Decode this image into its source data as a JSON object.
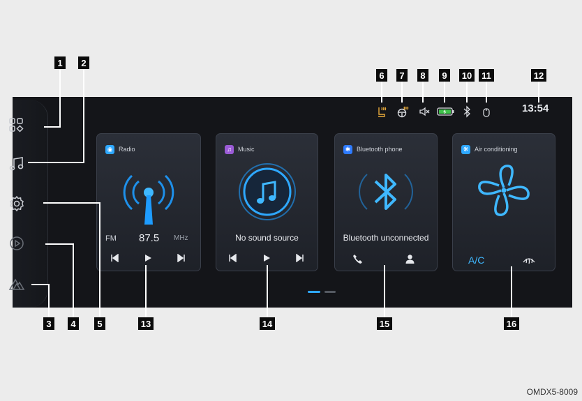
{
  "status": {
    "time": "13:54"
  },
  "cards": {
    "radio": {
      "title": "Radio",
      "band": "FM",
      "frequency": "87.5",
      "unit": "MHz"
    },
    "music": {
      "title": "Music",
      "source": "No sound source"
    },
    "bluetooth": {
      "title": "Bluetooth phone",
      "status": "Bluetooth unconnected"
    },
    "ac": {
      "title": "Air conditioning",
      "ac_label": "A/C"
    }
  },
  "callouts": [
    "1",
    "2",
    "3",
    "4",
    "5",
    "6",
    "7",
    "8",
    "9",
    "10",
    "11",
    "12",
    "13",
    "14",
    "15",
    "16"
  ],
  "caption": "OMDX5-8009",
  "colors": {
    "accent": "#2ea8ff",
    "background": "#141519",
    "card": "#262a32"
  }
}
